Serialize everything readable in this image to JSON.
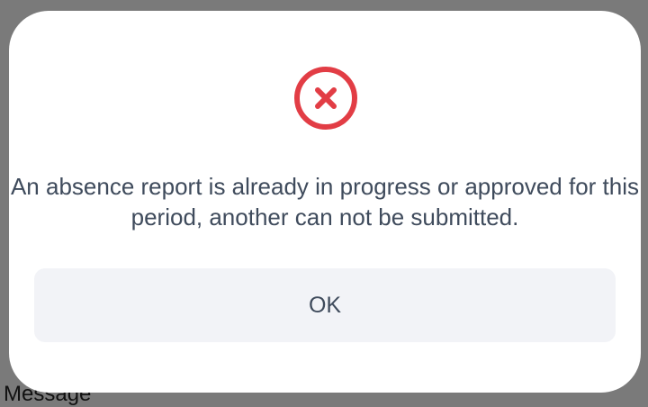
{
  "background": {
    "partial_text": "Message"
  },
  "dialog": {
    "icon": "error-circle-x-icon",
    "icon_color": "#e23d45",
    "message": "An absence report is already in progress or approved for this period, another can not be submitted.",
    "ok_label": "OK"
  },
  "colors": {
    "overlay": "#7a7a7a",
    "dialog_background": "#ffffff",
    "text": "#3f4b5c",
    "button_background": "#f2f3f7"
  }
}
